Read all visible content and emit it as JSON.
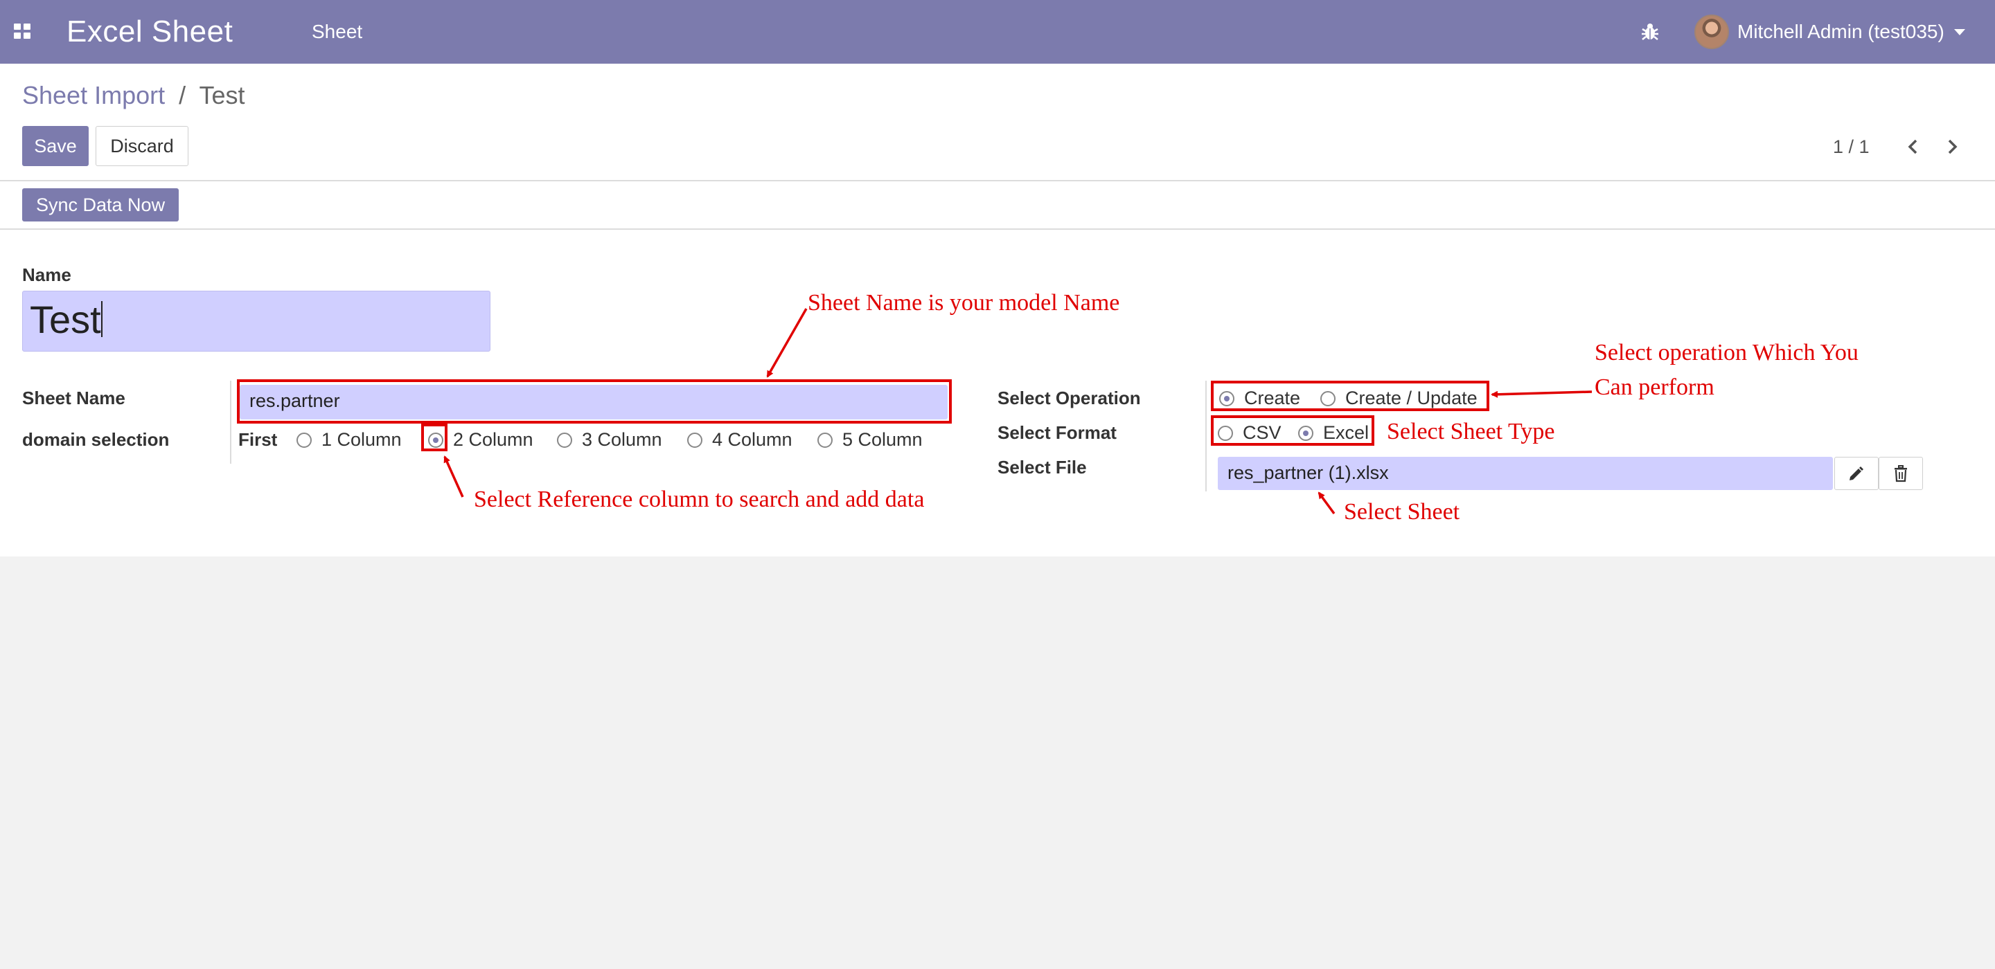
{
  "navbar": {
    "brand": "Excel Sheet",
    "menu_sheet": "Sheet",
    "user_name": "Mitchell Admin (test035)"
  },
  "breadcrumb": {
    "parent": "Sheet Import",
    "separator": "/",
    "current": "Test"
  },
  "buttons": {
    "save": "Save",
    "discard": "Discard",
    "sync": "Sync Data Now"
  },
  "pager": {
    "value": "1 / 1"
  },
  "form": {
    "name_label": "Name",
    "name_value": "Test",
    "sheet_name_label": "Sheet Name",
    "sheet_name_value": "res.partner",
    "domain_label": "domain selection",
    "domain_prefix": "First",
    "domain_options": [
      "1 Column",
      "2 Column",
      "3 Column",
      "4 Column",
      "5 Column"
    ],
    "domain_selected": "2 Column",
    "operation_label": "Select Operation",
    "operation_options": [
      "Create",
      "Create / Update"
    ],
    "operation_selected": "Create",
    "format_label": "Select Format",
    "format_options": [
      "CSV",
      "Excel"
    ],
    "format_selected": "Excel",
    "file_label": "Select File",
    "file_value": "res_partner (1).xlsx"
  },
  "annotations": {
    "sheet_name_note": "Sheet Name is your model Name",
    "operation_note_line1": "Select operation Which You",
    "operation_note_line2": "Can perform",
    "sheet_type_note": "Select Sheet Type",
    "reference_note": "Select Reference column to search and add data",
    "select_sheet_note": "Select Sheet"
  },
  "colors": {
    "primary": "#7c7bad",
    "field_bg": "#d0cfff",
    "annotation_red": "#e00000",
    "background": "#f2f2f2"
  },
  "icons": [
    "apps-icon",
    "bug-icon",
    "avatar",
    "caret-down-icon",
    "chevron-left-icon",
    "chevron-right-icon",
    "pencil-icon",
    "trash-icon"
  ]
}
